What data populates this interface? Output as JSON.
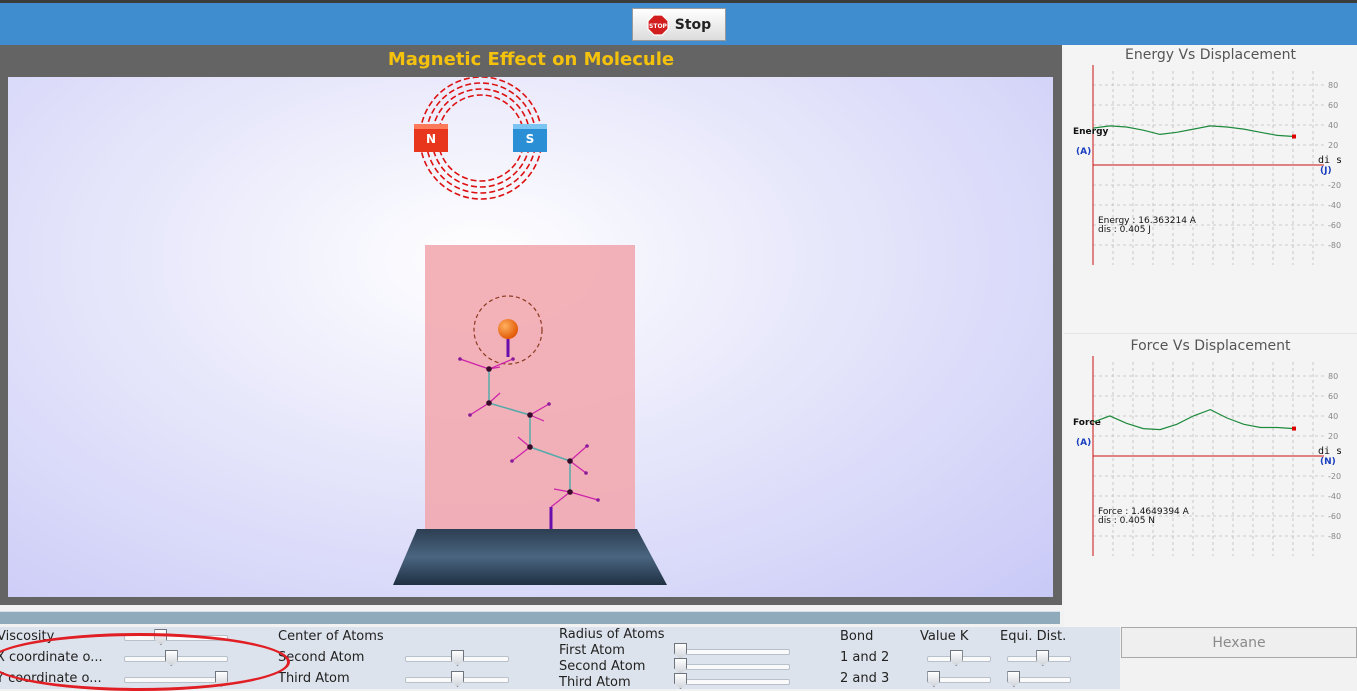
{
  "toolbar": {
    "stop_label": "Stop",
    "stop_icon_text": "STOP"
  },
  "simulation": {
    "title": "Magnetic Effect on Molecule",
    "magnet_north": "N",
    "magnet_south": "S"
  },
  "energy_graph": {
    "title": "Energy Vs Displacement",
    "y_label": "Energy",
    "y_unit": "(A)",
    "x_label": "di s",
    "x_unit": "(J)",
    "readout_line1": "Energy : 16.363214 A",
    "readout_line2": "dis : 0.405 J",
    "ticks": [
      "80",
      "60",
      "40",
      "20",
      "-20",
      "-40",
      "-60",
      "-80"
    ]
  },
  "force_graph": {
    "title": "Force Vs Displacement",
    "y_label": "Force",
    "y_unit": "(A)",
    "x_label": "di s",
    "x_unit": "(N)",
    "readout_line1": "Force : 1.4649394 A",
    "readout_line2": "dis : 0.405 N",
    "ticks": [
      "80",
      "60",
      "40",
      "20",
      "-20",
      "-40",
      "-60",
      "-80"
    ]
  },
  "chart_data": [
    {
      "type": "line",
      "title": "Energy Vs Displacement",
      "ylabel": "Energy",
      "xlabel": "di s",
      "ylim": [
        -90,
        90
      ],
      "series": [
        {
          "values": [
            35,
            37,
            36,
            33,
            29,
            31,
            34,
            37,
            36,
            34,
            31,
            28,
            27
          ]
        }
      ]
    },
    {
      "type": "line",
      "title": "Force Vs Displacement",
      "ylabel": "Force",
      "xlabel": "di s",
      "ylim": [
        -90,
        90
      ],
      "series": [
        {
          "values": [
            32,
            38,
            31,
            26,
            25,
            30,
            38,
            44,
            36,
            30,
            27,
            27,
            26
          ]
        }
      ]
    }
  ],
  "controls": {
    "viscosity_label": "Viscosity",
    "viscosity_value": 0.35,
    "x_coord_label": "X coordinate o...",
    "x_coord_value": 0.45,
    "y_coord_label": "Y coordinate o...",
    "y_coord_value": 0.93,
    "center_title": "Center of Atoms",
    "center_second_label": "Second Atom",
    "center_second_value": 0.5,
    "center_third_label": "Third Atom",
    "center_third_value": 0.5,
    "radius_title": "Radius of Atoms",
    "radius_first_label": "First Atom",
    "radius_first_value": 0.0,
    "radius_second_label": "Second Atom",
    "radius_second_value": 0.0,
    "radius_third_label": "Third Atom",
    "radius_third_value": 0.0,
    "bond_title": "Bond",
    "value_k_title": "Value K",
    "equi_dist_title": "Equi. Dist.",
    "bond_12_label": "1 and 2",
    "bond_12_k": 0.45,
    "bond_12_dist": 0.55,
    "bond_23_label": "2 and 3",
    "bond_23_k": 0.1,
    "bond_23_dist": 0.1
  },
  "molecule_button": {
    "label": "Hexane"
  },
  "colors": {
    "accent": "#3f8ccf",
    "title": "#f4c20d",
    "plot_line": "#1d8a3c",
    "axis": "#cc1111",
    "highlight": "#e01e24"
  }
}
